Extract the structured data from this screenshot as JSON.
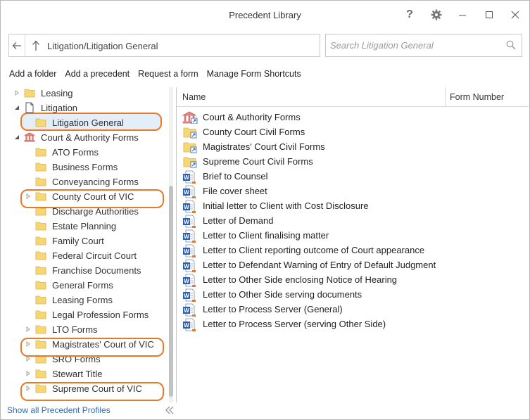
{
  "window": {
    "title": "Precedent Library"
  },
  "address": {
    "path": "Litigation/Litigation General"
  },
  "search": {
    "placeholder": "Search Litigation General"
  },
  "toolbar": {
    "add_folder": "Add a folder",
    "add_precedent": "Add a precedent",
    "request_form": "Request a form",
    "manage_shortcuts": "Manage Form Shortcuts"
  },
  "tree": {
    "items": [
      {
        "label": "Leasing",
        "icon": "folder-icon",
        "expander": "collapsed"
      },
      {
        "label": "Litigation",
        "icon": "document-icon",
        "expander": "expanded"
      },
      {
        "label": "Litigation General",
        "icon": "folder-icon",
        "expander": "none",
        "selected": true
      },
      {
        "label": "Court & Authority Forms",
        "icon": "bank-icon",
        "expander": "expanded"
      },
      {
        "label": "ATO Forms",
        "icon": "folder-icon",
        "expander": "none"
      },
      {
        "label": "Business Forms",
        "icon": "folder-icon",
        "expander": "none"
      },
      {
        "label": "Conveyancing Forms",
        "icon": "folder-icon",
        "expander": "none"
      },
      {
        "label": "County Court of VIC",
        "icon": "folder-icon",
        "expander": "collapsed",
        "highlighted": true
      },
      {
        "label": "Discharge Authorities",
        "icon": "folder-icon",
        "expander": "none"
      },
      {
        "label": "Estate Planning",
        "icon": "folder-icon",
        "expander": "none"
      },
      {
        "label": "Family Court",
        "icon": "folder-icon",
        "expander": "none"
      },
      {
        "label": "Federal Circuit Court",
        "icon": "folder-icon",
        "expander": "none"
      },
      {
        "label": "Franchise Documents",
        "icon": "folder-icon",
        "expander": "none"
      },
      {
        "label": "General Forms",
        "icon": "folder-icon",
        "expander": "none"
      },
      {
        "label": "Leasing Forms",
        "icon": "folder-icon",
        "expander": "none"
      },
      {
        "label": "Legal Profession Forms",
        "icon": "folder-icon",
        "expander": "none"
      },
      {
        "label": "LTO Forms",
        "icon": "folder-icon",
        "expander": "collapsed"
      },
      {
        "label": "Magistrates' Court of VIC",
        "icon": "folder-icon",
        "expander": "collapsed",
        "highlighted": true
      },
      {
        "label": "SRO Forms",
        "icon": "folder-icon",
        "expander": "collapsed"
      },
      {
        "label": "Stewart Title",
        "icon": "folder-icon",
        "expander": "collapsed"
      },
      {
        "label": "Supreme Court of VIC",
        "icon": "folder-icon",
        "expander": "collapsed",
        "highlighted": true
      }
    ]
  },
  "footer": {
    "show_all": "Show all Precedent Profiles"
  },
  "list": {
    "columns": [
      "Name",
      "Form Number"
    ],
    "rows": [
      {
        "name": "Court & Authority Forms",
        "icon": "bank-shortcut-icon"
      },
      {
        "name": "County Court Civil Forms",
        "icon": "folder-shortcut-icon"
      },
      {
        "name": "Magistrates' Court Civil Forms",
        "icon": "folder-shortcut-icon"
      },
      {
        "name": "Supreme Court Civil Forms",
        "icon": "folder-shortcut-icon"
      },
      {
        "name": "Brief to Counsel",
        "icon": "word-doc-icon"
      },
      {
        "name": "File cover sheet",
        "icon": "word-doc-icon"
      },
      {
        "name": "Initial letter to Client with Cost Disclosure",
        "icon": "word-doc-icon"
      },
      {
        "name": "Letter of Demand",
        "icon": "word-doc-icon"
      },
      {
        "name": "Letter to Client finalising matter",
        "icon": "word-doc-icon"
      },
      {
        "name": "Letter to Client reporting outcome of Court appearance",
        "icon": "word-doc-icon"
      },
      {
        "name": "Letter to Defendant Warning of Entry of Default Judgment",
        "icon": "word-doc-icon"
      },
      {
        "name": "Letter to Other Side enclosing Notice of Hearing",
        "icon": "word-doc-icon"
      },
      {
        "name": "Letter to Other Side serving documents",
        "icon": "word-doc-icon"
      },
      {
        "name": "Letter to Process Server (General)",
        "icon": "word-doc-icon"
      },
      {
        "name": "Letter to Process Server (serving Other Side)",
        "icon": "word-doc-icon"
      }
    ]
  },
  "colors": {
    "accent": "#e8782a",
    "folder": "#f7d774",
    "link": "#2f6eb5",
    "word": "#2b5fb4",
    "bank": "#d9534f",
    "selection": "#e3eef9"
  }
}
